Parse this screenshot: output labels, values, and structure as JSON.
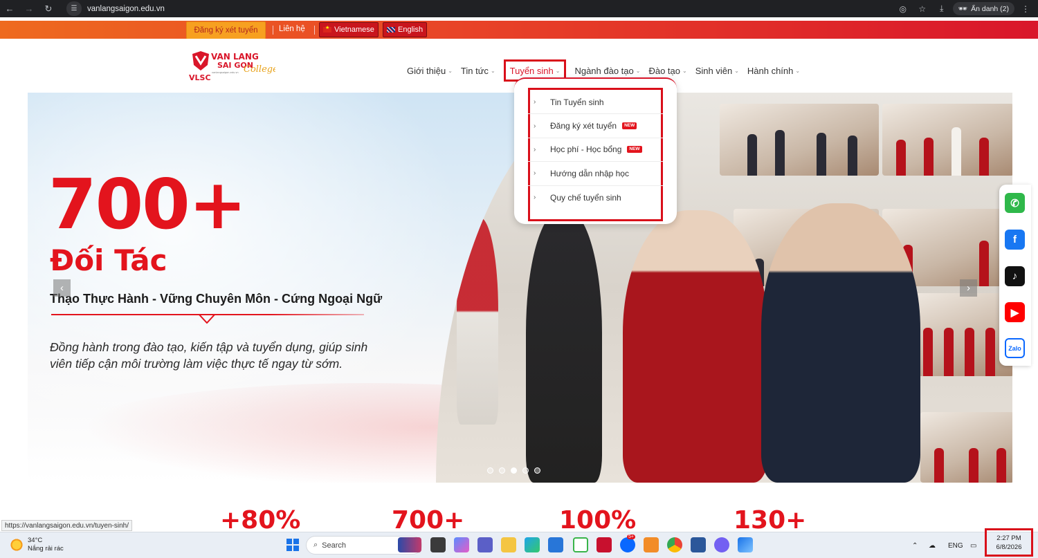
{
  "browser": {
    "url": "vanlangsaigon.edu.vn",
    "incognito_label": "Ẩn danh (2)",
    "status_url": "https://vanlangsaigon.edu.vn/tuyen-sinh/"
  },
  "topbar": {
    "register": "Đăng ký xét tuyển",
    "contact": "Liên hệ",
    "lang_vi": "Vietnamese",
    "lang_en": "English"
  },
  "logo": {
    "line1": "VAN LANG",
    "line2": "SAI GON",
    "script": "College",
    "abbr": "VLSC",
    "domain": "vanlangsaigon.edu.vn"
  },
  "menu": {
    "items": [
      {
        "label": "Giới thiệu"
      },
      {
        "label": "Tin tức"
      },
      {
        "label": "Tuyển sinh"
      },
      {
        "label": "Ngành đào tạo"
      },
      {
        "label": "Đào tạo"
      },
      {
        "label": "Sinh viên"
      },
      {
        "label": "Hành chính"
      }
    ]
  },
  "dropdown": {
    "items": [
      {
        "label": "Tin Tuyển sinh",
        "badge": ""
      },
      {
        "label": "Đăng ký xét tuyển",
        "badge": "NEW"
      },
      {
        "label": "Học phí - Học bổng",
        "badge": "NEW"
      },
      {
        "label": "Hướng dẫn nhập học",
        "badge": ""
      },
      {
        "label": "Quy chế tuyển sinh",
        "badge": ""
      }
    ]
  },
  "hero": {
    "stat": "700+",
    "stat_label": "Đối Tác",
    "tagline": "Thạo Thực Hành - Vững Chuyên Môn - Cứng Ngoại Ngữ",
    "description": "Đồng hành trong đào tạo, kiến tập và tuyển dụng, giúp sinh viên tiếp cận môi trường làm việc thực tế ngay từ sớm.",
    "slide_count": 5,
    "active_slide": 3
  },
  "social": {
    "zalo": "Zalo"
  },
  "stats_row": [
    "+80%",
    "700+",
    "100%",
    "130+"
  ],
  "taskbar": {
    "temperature": "34°C",
    "weather": "Nắng rải rác",
    "search": "Search",
    "lang": "ENG",
    "time": "2:27 PM",
    "date": "6/8/2026",
    "notif_badge": "5+"
  },
  "colors": {
    "brand_red": "#e3141d",
    "highlight_box": "#d90f1a",
    "register_bg": "#f7a020"
  }
}
